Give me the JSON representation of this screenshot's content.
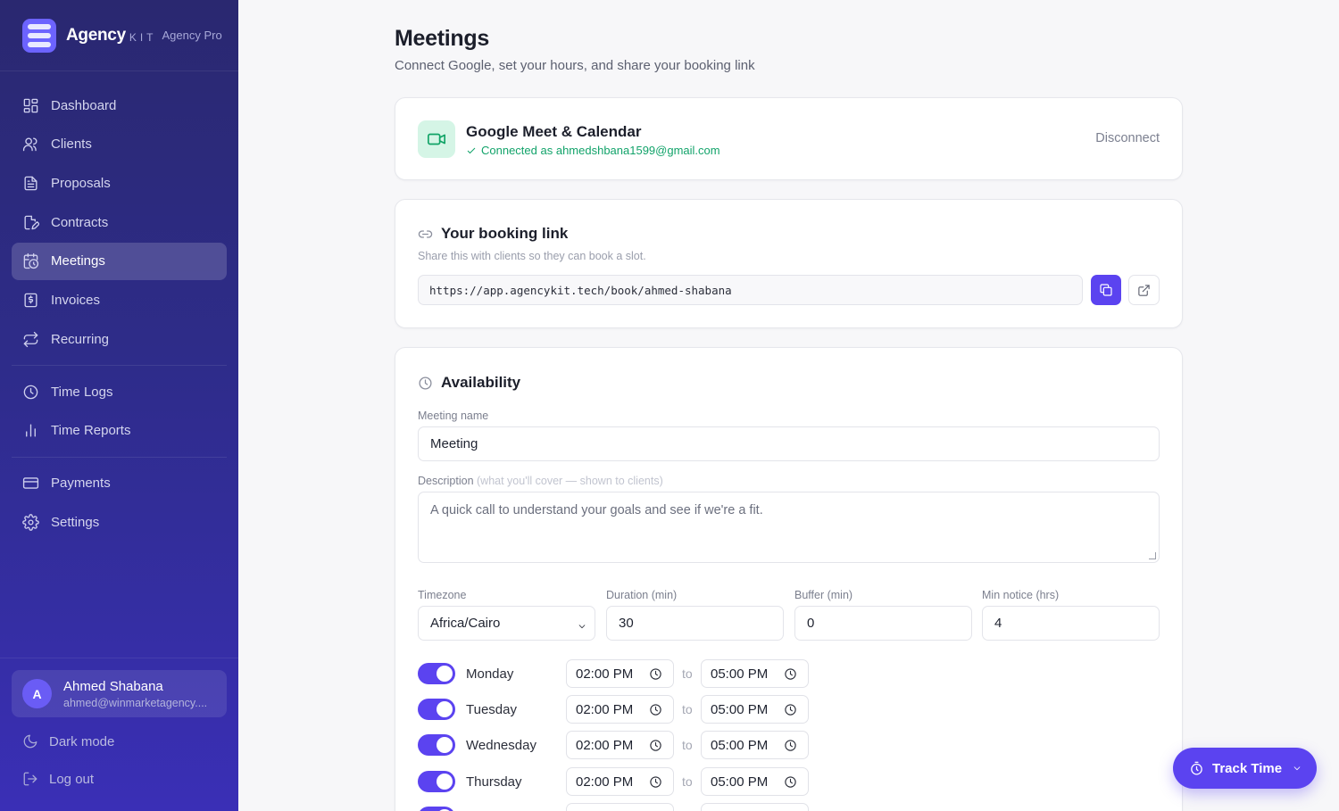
{
  "brand": {
    "name": "Agency",
    "kit": "KIT",
    "plan": "Agency Pro"
  },
  "nav": {
    "items": [
      {
        "label": "Dashboard",
        "icon": "dashboard-icon"
      },
      {
        "label": "Clients",
        "icon": "users-icon"
      },
      {
        "label": "Proposals",
        "icon": "document-icon"
      },
      {
        "label": "Contracts",
        "icon": "contract-icon"
      },
      {
        "label": "Meetings",
        "icon": "calendar-clock-icon",
        "active": true
      },
      {
        "label": "Invoices",
        "icon": "invoice-icon"
      },
      {
        "label": "Recurring",
        "icon": "repeat-icon"
      }
    ],
    "time_items": [
      {
        "label": "Time Logs",
        "icon": "clock-icon"
      },
      {
        "label": "Time Reports",
        "icon": "bar-chart-icon"
      }
    ],
    "settings_items": [
      {
        "label": "Payments",
        "icon": "credit-card-icon"
      },
      {
        "label": "Settings",
        "icon": "gear-icon"
      }
    ]
  },
  "user": {
    "initial": "A",
    "name": "Ahmed Shabana",
    "email": "ahmed@winmarketagency...."
  },
  "bottom": {
    "dark_mode": "Dark mode",
    "logout": "Log out"
  },
  "page": {
    "title": "Meetings",
    "subtitle": "Connect Google, set your hours, and share your booking link"
  },
  "google": {
    "title": "Google Meet & Calendar",
    "status": "Connected as ahmedshbana1599@gmail.com",
    "disconnect": "Disconnect"
  },
  "booking": {
    "title": "Your booking link",
    "hint": "Share this with clients so they can book a slot.",
    "url": "https://app.agencykit.tech/book/ahmed-shabana"
  },
  "availability": {
    "title": "Availability",
    "meeting_name_label": "Meeting name",
    "meeting_name_value": "Meeting",
    "description_label": "Description",
    "description_hint": "(what you'll cover — shown to clients)",
    "description_value": "A quick call to understand your goals and see if we're a fit.",
    "timezone_label": "Timezone",
    "timezone_value": "Africa/Cairo",
    "duration_label": "Duration (min)",
    "duration_value": "30",
    "buffer_label": "Buffer (min)",
    "buffer_value": "0",
    "notice_label": "Min notice (hrs)",
    "notice_value": "4",
    "to_label": "to",
    "days": [
      {
        "name": "Monday",
        "enabled": true,
        "start": "02:00 PM",
        "end": "05:00 PM"
      },
      {
        "name": "Tuesday",
        "enabled": true,
        "start": "02:00 PM",
        "end": "05:00 PM"
      },
      {
        "name": "Wednesday",
        "enabled": true,
        "start": "02:00 PM",
        "end": "05:00 PM"
      },
      {
        "name": "Thursday",
        "enabled": true,
        "start": "02:00 PM",
        "end": "05:00 PM"
      },
      {
        "name": "",
        "enabled": true,
        "start": "",
        "end": ""
      }
    ]
  },
  "track_time": {
    "label": "Track Time"
  },
  "colors": {
    "accent": "#5b43f0",
    "success": "#12a36a",
    "sidebar": "#2e2c8a"
  }
}
